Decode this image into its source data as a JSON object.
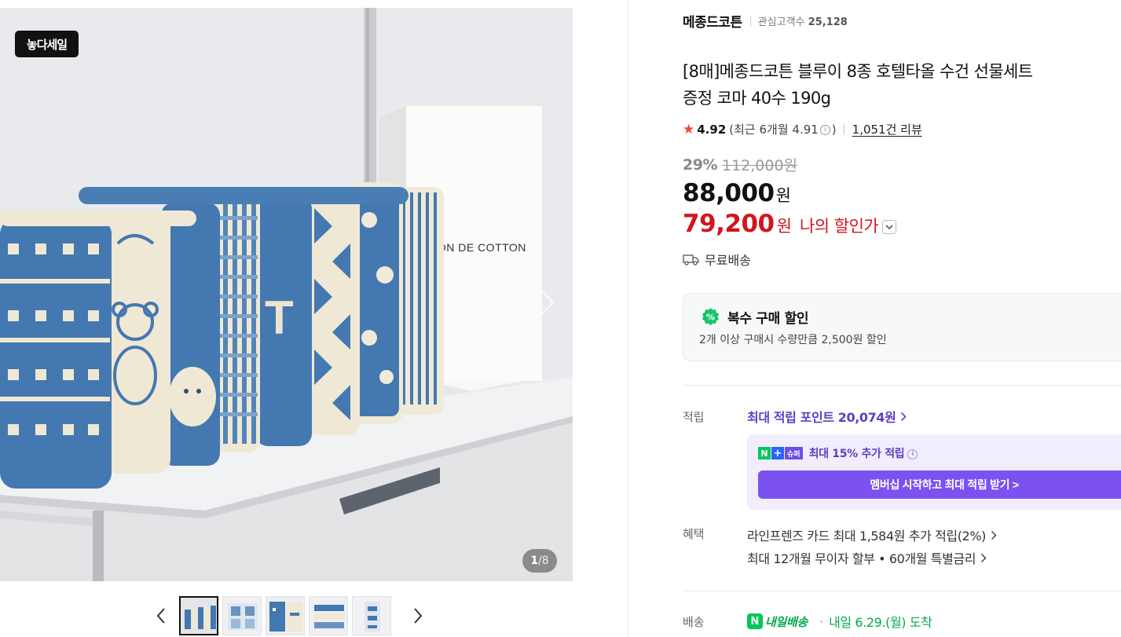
{
  "gallery": {
    "badge": "놓다세일",
    "counter_current": "1",
    "counter_total": "/8",
    "image_brand_text": "SON DE COTTON",
    "thumbnail_count": 5
  },
  "store": {
    "name": "메종드코튼",
    "fans_label": "관심고객수",
    "fans_count": "25,128"
  },
  "product": {
    "title_line1": "[8매]메종드코튼 블루이 8종 호텔타올 수건 선물세트",
    "title_line2": "증정 코마 40수 190g",
    "rating": "4.92",
    "recent_prefix": "(최근 6개월 4.91",
    "recent_suffix": ")",
    "reviews": "1,051건 리뷰",
    "discount": "29%",
    "original_price": "112,000원",
    "price": "88,000",
    "price_unit": "원",
    "my_price": "79,200",
    "my_price_unit": "원",
    "my_price_label": "나의 할인가",
    "shipping": "무료배송"
  },
  "bulk": {
    "title": "복수 구매 할인",
    "desc": "2개 이상 구매시 수량만큼 2,500원 할인"
  },
  "points": {
    "label": "적립",
    "max_points": "최대 적립 포인트 20,074원",
    "nplus_super": "슈퍼",
    "nplus_text": "최대 15% 추가 적립",
    "membership_button": "멤버십 시작하고 최대 적립 받기 >"
  },
  "benefits": {
    "label": "혜택",
    "line1": "라인프렌즈 카드 최대 1,584원 추가 적립(2%)",
    "line2": "최대 12개월 무이자 할부 • 60개월 특별금리"
  },
  "delivery": {
    "label": "배송",
    "badge_text": "내일배송",
    "date": "내일 6.29.(월) 도착"
  },
  "colors": {
    "accent_purple": "#7b52f0",
    "price_red": "#d2151e",
    "naver_green": "#03c75a",
    "towel_blue": "#3f74ad"
  }
}
